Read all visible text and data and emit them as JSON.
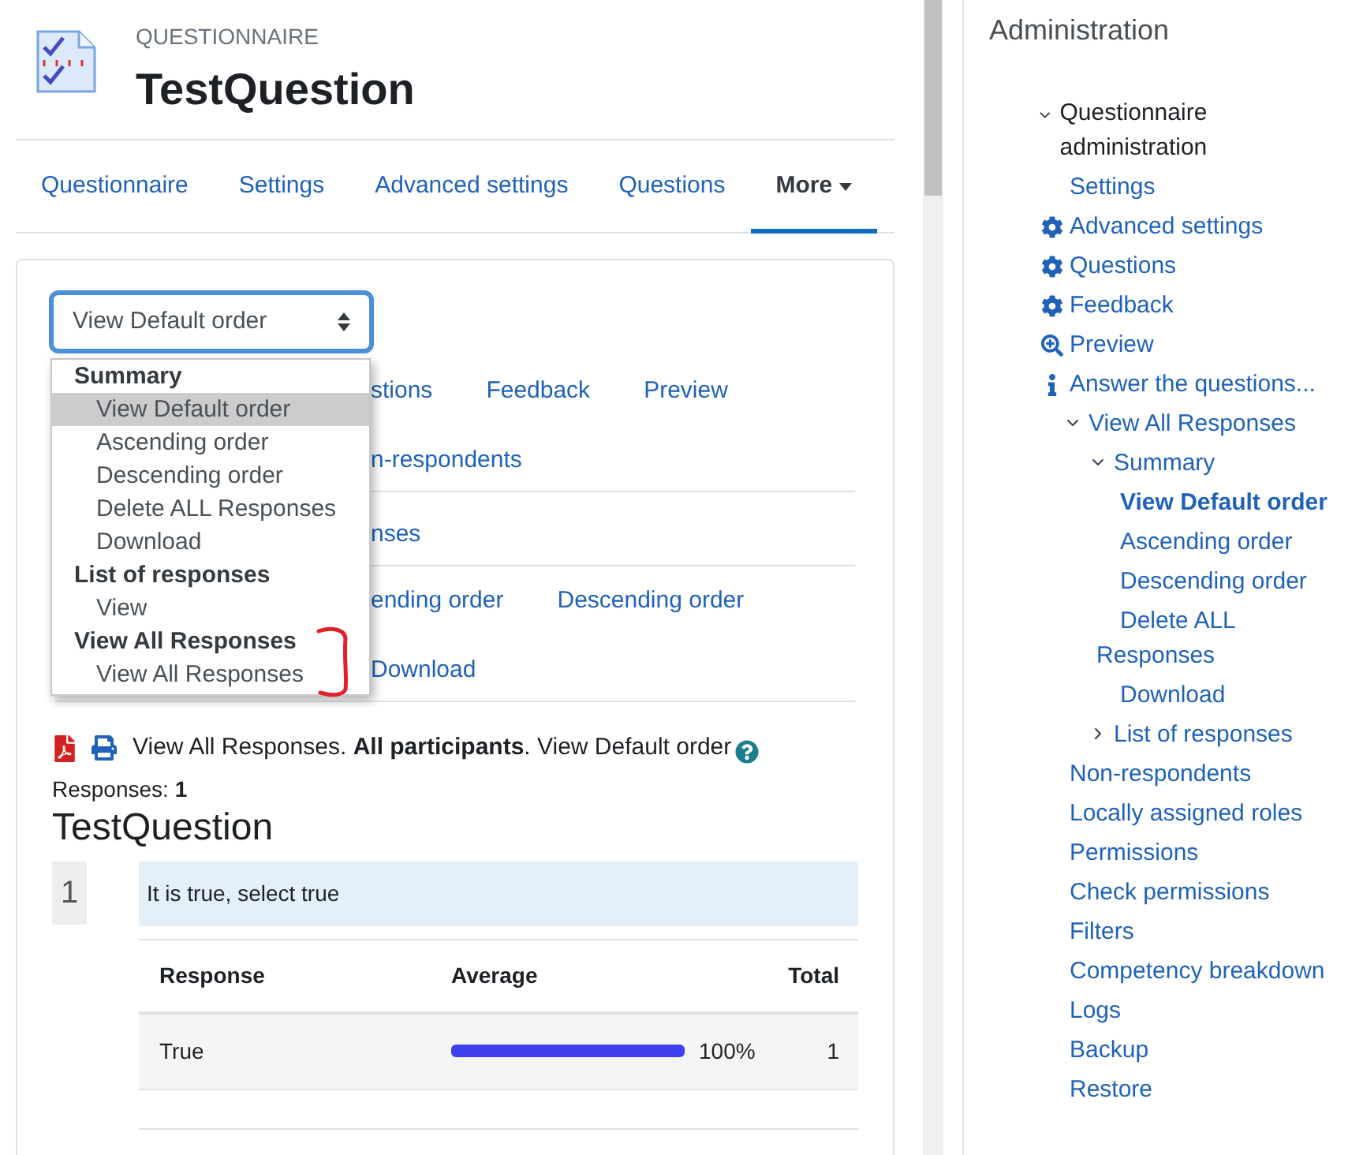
{
  "header": {
    "kicker": "QUESTIONNAIRE",
    "title": "TestQuestion"
  },
  "tabs": [
    {
      "label": "Questionnaire",
      "selected": false
    },
    {
      "label": "Settings",
      "selected": false
    },
    {
      "label": "Advanced settings",
      "selected": false
    },
    {
      "label": "Questions",
      "selected": false
    },
    {
      "label": "More",
      "selected": true,
      "kind": "menu"
    }
  ],
  "select": {
    "value": "View Default order",
    "expanded": true,
    "menu": [
      {
        "label": "Summary",
        "kind": "group",
        "selected": false
      },
      {
        "label": "View Default order",
        "kind": "option",
        "selected": true
      },
      {
        "label": "Ascending order",
        "kind": "option",
        "selected": false
      },
      {
        "label": "Descending order",
        "kind": "option",
        "selected": false
      },
      {
        "label": "Delete ALL Responses",
        "kind": "option",
        "selected": false
      },
      {
        "label": "Download",
        "kind": "option",
        "selected": false
      },
      {
        "label": "List of responses",
        "kind": "group",
        "selected": false
      },
      {
        "label": "View",
        "kind": "option",
        "selected": false
      },
      {
        "label": "View All Responses",
        "kind": "group",
        "selected": false
      },
      {
        "label": "View All Responses",
        "kind": "option",
        "selected": false
      }
    ]
  },
  "sub_nav": [
    {
      "links": [
        "stions",
        "Feedback",
        "Preview"
      ],
      "divider": false
    },
    {
      "links": [
        "n-respondents"
      ],
      "divider": true
    },
    {
      "links": [
        "nses"
      ],
      "divider": true
    },
    {
      "links": [
        "ending order",
        "Descending order"
      ],
      "divider": false
    },
    {
      "links": [
        "Download"
      ],
      "divider": true
    }
  ],
  "report": {
    "summary": "View All Responses. **All participants**. View Default order",
    "responses": "Responses: **1**",
    "title": "TestQuestion",
    "question": {
      "number": "1",
      "text": "It is true, select true",
      "columns": [
        "Response",
        "Average",
        "Total"
      ],
      "rows": [
        {
          "response": "True",
          "level": 1,
          "percent": "100%",
          "total": "1"
        }
      ]
    }
  },
  "admin": {
    "title": "Administration",
    "tree": [
      {
        "label": "Questionnaire administration",
        "kind": "branch",
        "expanded": true,
        "selected": false,
        "children": [
          {
            "label": "Settings",
            "kind": "plain",
            "selected": false
          },
          {
            "label": "Advanced settings",
            "kind": "gear",
            "selected": false
          },
          {
            "label": "Questions",
            "kind": "gear",
            "selected": false
          },
          {
            "label": "Feedback",
            "kind": "gear",
            "selected": false
          },
          {
            "label": "Preview",
            "kind": "preview",
            "selected": false
          },
          {
            "label": "Answer the questions...",
            "kind": "info",
            "selected": false
          },
          {
            "label": "View All Responses",
            "kind": "branch",
            "expanded": true,
            "selected": false,
            "children": [
              {
                "label": "Summary",
                "kind": "branch",
                "expanded": true,
                "selected": false,
                "children": [
                  {
                    "label": "View Default order",
                    "selected": true
                  },
                  {
                    "label": "Ascending order",
                    "selected": false
                  },
                  {
                    "label": "Descending order",
                    "selected": false
                  },
                  {
                    "label": "Delete ALL Responses",
                    "selected": false
                  },
                  {
                    "label": "Download",
                    "selected": false
                  }
                ]
              },
              {
                "label": "List of responses",
                "kind": "branch",
                "expanded": false,
                "selected": false
              }
            ]
          },
          {
            "label": "Non-respondents",
            "kind": "plain",
            "selected": false
          },
          {
            "label": "Locally assigned roles",
            "kind": "plain",
            "selected": false
          },
          {
            "label": "Permissions",
            "kind": "plain",
            "selected": false
          },
          {
            "label": "Check permissions",
            "kind": "plain",
            "selected": false
          },
          {
            "label": "Filters",
            "kind": "plain",
            "selected": false
          },
          {
            "label": "Competency breakdown",
            "kind": "plain",
            "selected": false
          },
          {
            "label": "Logs",
            "kind": "plain",
            "selected": false
          },
          {
            "label": "Backup",
            "kind": "plain",
            "selected": false
          },
          {
            "label": "Restore",
            "kind": "plain",
            "selected": false
          }
        ]
      }
    ]
  }
}
